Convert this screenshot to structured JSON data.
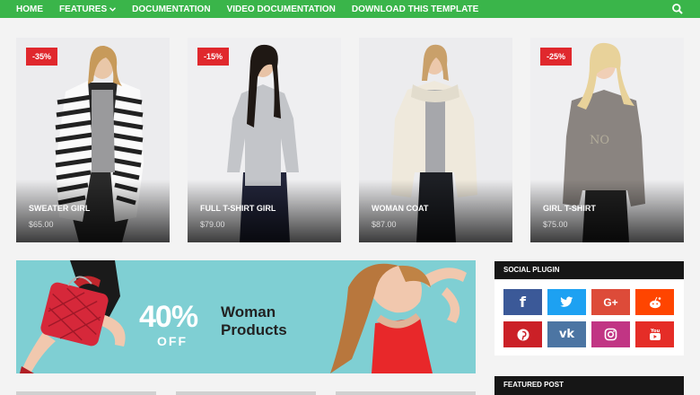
{
  "nav": {
    "items": [
      {
        "label": "HOME"
      },
      {
        "label": "FEATURES"
      },
      {
        "label": "DOCUMENTATION"
      },
      {
        "label": "VIDEO DOCUMENTATION"
      },
      {
        "label": "DOWNLOAD THIS TEMPLATE"
      }
    ],
    "features_chevron": "chevron-down-icon",
    "search_icon": "search-icon"
  },
  "products": [
    {
      "badge": "-35%",
      "name": "SWEATER GIRL",
      "price": "$65.00"
    },
    {
      "badge": "-15%",
      "name": "FULL T-SHIRT GIRL",
      "price": "$79.00"
    },
    {
      "badge": "",
      "name": "WOMAN COAT",
      "price": "$87.00"
    },
    {
      "badge": "-25%",
      "name": "GIRL T-SHIRT",
      "price": "$75.00"
    }
  ],
  "banner": {
    "percent": "40%",
    "off": "OFF",
    "line1": "Woman",
    "line2": "Products"
  },
  "sidebar": {
    "social_title": "SOCIAL PLUGIN",
    "featured_title": "FEATURED POST",
    "social": [
      {
        "icon": "facebook-icon",
        "glyph": "f",
        "color": "#3b5998"
      },
      {
        "icon": "twitter-icon",
        "glyph": "t",
        "color": "#1da1f2"
      },
      {
        "icon": "google-plus-icon",
        "glyph": "G+",
        "color": "#dd4b39"
      },
      {
        "icon": "reddit-icon",
        "glyph": "r",
        "color": "#ff4500"
      },
      {
        "icon": "pinterest-icon",
        "glyph": "p",
        "color": "#cb2027"
      },
      {
        "icon": "vk-icon",
        "glyph": "vk",
        "color": "#4c75a3"
      },
      {
        "icon": "instagram-icon",
        "glyph": "ig",
        "color": "#c13584"
      },
      {
        "icon": "youtube-icon",
        "glyph": "yt",
        "color": "#e52d27"
      }
    ]
  },
  "colors": {
    "nav_green": "#3ab54a",
    "badge_red": "#e0282d",
    "banner_teal": "#7fcfd3"
  }
}
